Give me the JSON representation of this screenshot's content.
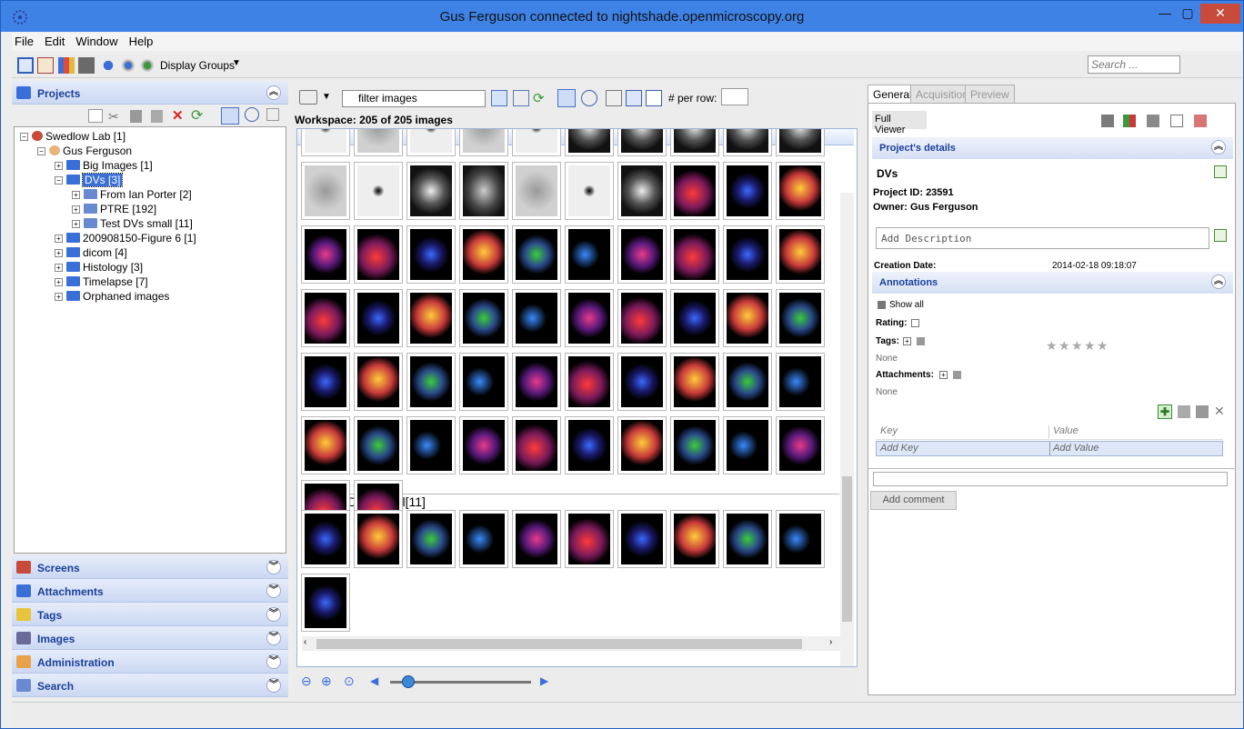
{
  "window": {
    "title": "Gus Ferguson connected to nightshade.openmicroscopy.org",
    "min": "—",
    "max": "▢",
    "close": "✕"
  },
  "menu": [
    "File",
    "Edit",
    "Window",
    "Help"
  ],
  "toolbar": {
    "display_groups": "Display Groups",
    "search_placeholder": "Search ..."
  },
  "left": {
    "projects_label": "Projects",
    "tree": [
      {
        "label": "Swedlow Lab [1]",
        "depth": 0,
        "expander": "−",
        "kind": "group"
      },
      {
        "label": "Gus Ferguson",
        "depth": 1,
        "expander": "−",
        "kind": "user"
      },
      {
        "label": "Big Images [1]",
        "depth": 2,
        "expander": "+",
        "kind": "project"
      },
      {
        "label": "DVs [3]",
        "depth": 2,
        "expander": "−",
        "kind": "project",
        "selected": true
      },
      {
        "label": "From Ian Porter [2]",
        "depth": 3,
        "expander": "+",
        "kind": "dataset"
      },
      {
        "label": "PTRE [192]",
        "depth": 3,
        "expander": "+",
        "kind": "dataset"
      },
      {
        "label": "Test DVs small [11]",
        "depth": 3,
        "expander": "+",
        "kind": "dataset"
      },
      {
        "label": "200908150-Figure 6 [1]",
        "depth": 2,
        "expander": "+",
        "kind": "project"
      },
      {
        "label": "dicom [4]",
        "depth": 2,
        "expander": "+",
        "kind": "project"
      },
      {
        "label": "Histology [3]",
        "depth": 2,
        "expander": "+",
        "kind": "project"
      },
      {
        "label": "Timelapse [7]",
        "depth": 2,
        "expander": "+",
        "kind": "project"
      },
      {
        "label": "Orphaned images",
        "depth": 2,
        "expander": "+",
        "kind": "orphan"
      }
    ],
    "panels": [
      "Screens",
      "Attachments",
      "Tags",
      "Images",
      "Administration",
      "Search"
    ]
  },
  "center": {
    "filter_value": "filter  images",
    "per_row_label": "# per row:",
    "workspace_label": "Workspace: 205 of 205 images",
    "group2_label": "Test DVs small[11]",
    "colors": {
      "gray": "#b8b8b8",
      "dark": "#0a0a0a"
    }
  },
  "right": {
    "tabs": [
      "General",
      "Acquisition",
      "Preview"
    ],
    "full_viewer": "Full Viewer",
    "project_details": "Project's details",
    "name": "DVs",
    "project_id": "Project ID: 23591",
    "owner": "Owner: Gus Ferguson",
    "description_placeholder": "Add Description",
    "creation_label": "Creation Date:",
    "creation_value": "2014-02-18 09:18:07",
    "annotations": "Annotations",
    "show_all": "Show all",
    "rating_label": "Rating:",
    "rating_value": 0,
    "tags_label": "Tags:",
    "tags_none": "None",
    "attachments_label": "Attachments:",
    "attachments_none": "None",
    "key_header": "Key",
    "value_header": "Value",
    "add_key": "Add Key",
    "add_value": "Add Value",
    "add_comment": "Add comment"
  }
}
